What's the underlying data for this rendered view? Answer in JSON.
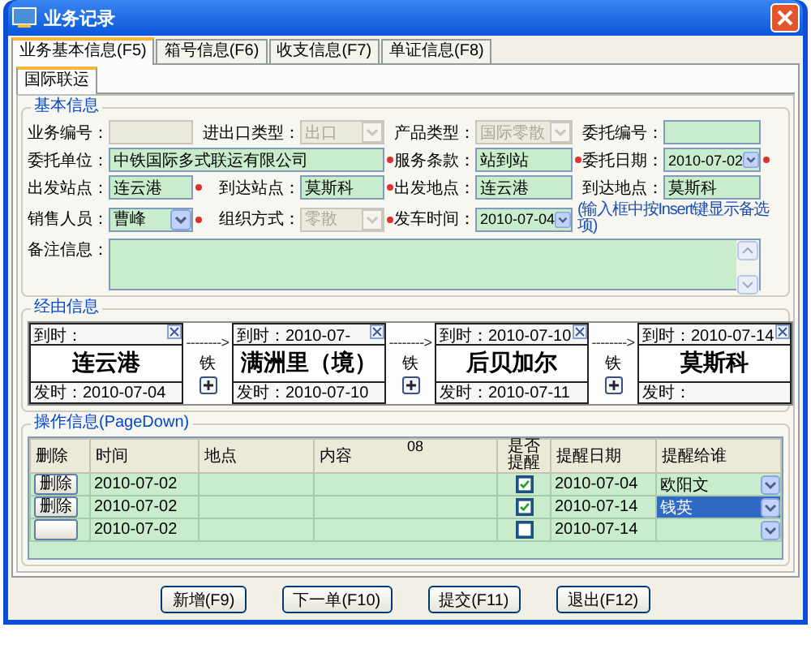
{
  "window": {
    "title": "业务记录"
  },
  "tabs": [
    {
      "label": "业务基本信息(F5)",
      "selected": true
    },
    {
      "label": "箱号信息(F6)",
      "selected": false
    },
    {
      "label": "收支信息(F7)",
      "selected": false
    },
    {
      "label": "单证信息(F8)",
      "selected": false
    }
  ],
  "sub_tabs": [
    {
      "label": "国际联运",
      "selected": true
    }
  ],
  "basic": {
    "title": "基本信息",
    "rows": [
      [
        {
          "kind": "text",
          "label": "业务编号：",
          "disabled": true,
          "required": false
        },
        {
          "kind": "select",
          "label": "进出口类型：",
          "value": "出口",
          "disabled": true,
          "required": false
        },
        {
          "kind": "select",
          "label": "产品类型：",
          "value": "国际零散",
          "disabled": true,
          "required": false
        },
        {
          "kind": "text",
          "label": "委托编号：",
          "disabled": false,
          "required": false
        }
      ],
      [
        {
          "kind": "text",
          "label": "委托单位：",
          "value": "中铁国际多式联运有限公司",
          "disabled": false,
          "required": true
        },
        {
          "kind": "empty"
        },
        {
          "kind": "text",
          "label": "服务条款：",
          "value": "站到站",
          "disabled": false,
          "required": true
        },
        {
          "kind": "select",
          "label": "委托日期：",
          "value": "2010-07-02",
          "disabled": false,
          "required": true
        }
      ],
      [
        {
          "kind": "text",
          "label": "出发站点：",
          "value": "连云港",
          "disabled": false,
          "required": true
        },
        {
          "kind": "text",
          "label": "到达站点：",
          "value": "莫斯科",
          "disabled": false,
          "required": true
        },
        {
          "kind": "text",
          "label": "出发地点：",
          "value": "连云港",
          "disabled": false,
          "required": false
        },
        {
          "kind": "text",
          "label": "到达地点：",
          "value": "莫斯科",
          "disabled": false,
          "required": false
        }
      ],
      [
        {
          "kind": "select",
          "label": "销售人员：",
          "value": "曹峰",
          "disabled": false,
          "required": true
        },
        {
          "kind": "select",
          "label": "组织方式：",
          "value": "零散",
          "disabled": true,
          "required": true
        },
        {
          "kind": "select",
          "label": "发车时间：",
          "value": "2010-07-04",
          "disabled": false,
          "required": false
        },
        {
          "kind": "hint",
          "text": "(输入框中按Insert键显示备选项)"
        }
      ],
      [
        {
          "kind": "textarea",
          "label": "备注信息：",
          "disabled": false,
          "required": false
        }
      ]
    ]
  },
  "route": {
    "title": "经由信息",
    "stops": [
      {
        "arrive": "到时：",
        "name": "连云港",
        "depart": "发时：2010-07-04"
      },
      {
        "arrive": "到时：2010-07-",
        "name": "满洲里（境）",
        "depart": "发时：2010-07-10"
      },
      {
        "arrive": "到时：2010-07-10",
        "name": "后贝加尔",
        "depart": "发时：2010-07-11"
      },
      {
        "arrive": "到时：2010-07-14",
        "name": "莫斯科",
        "depart": "发时："
      }
    ],
    "legs": [
      {
        "arrow": "-------->",
        "mode": "铁"
      },
      {
        "arrow": "-------->",
        "mode": "铁"
      },
      {
        "arrow": "-------->",
        "mode": "铁"
      }
    ]
  },
  "ops": {
    "title": "操作信息(PageDown)",
    "columns": [
      "删除",
      "时间",
      "地点",
      "内容",
      "是否提醒",
      "提醒日期",
      "提醒给谁"
    ],
    "header_note": "08",
    "rows": [
      {
        "delete": "删除",
        "time": "2010-07-02",
        "remind": true,
        "remind_date": "2010-07-04",
        "remind_to": "欧阳文",
        "selected": false
      },
      {
        "delete": "删除",
        "time": "2010-07-02",
        "remind": true,
        "remind_date": "2010-07-14",
        "remind_to": "钱英",
        "selected": true
      },
      {
        "time": "2010-07-02",
        "remind": false,
        "remind_date": "2010-07-14",
        "selected": false
      }
    ]
  },
  "buttons": [
    "新增(F9)",
    "下一单(F10)",
    "提交(F11)",
    "退出(F12)"
  ]
}
